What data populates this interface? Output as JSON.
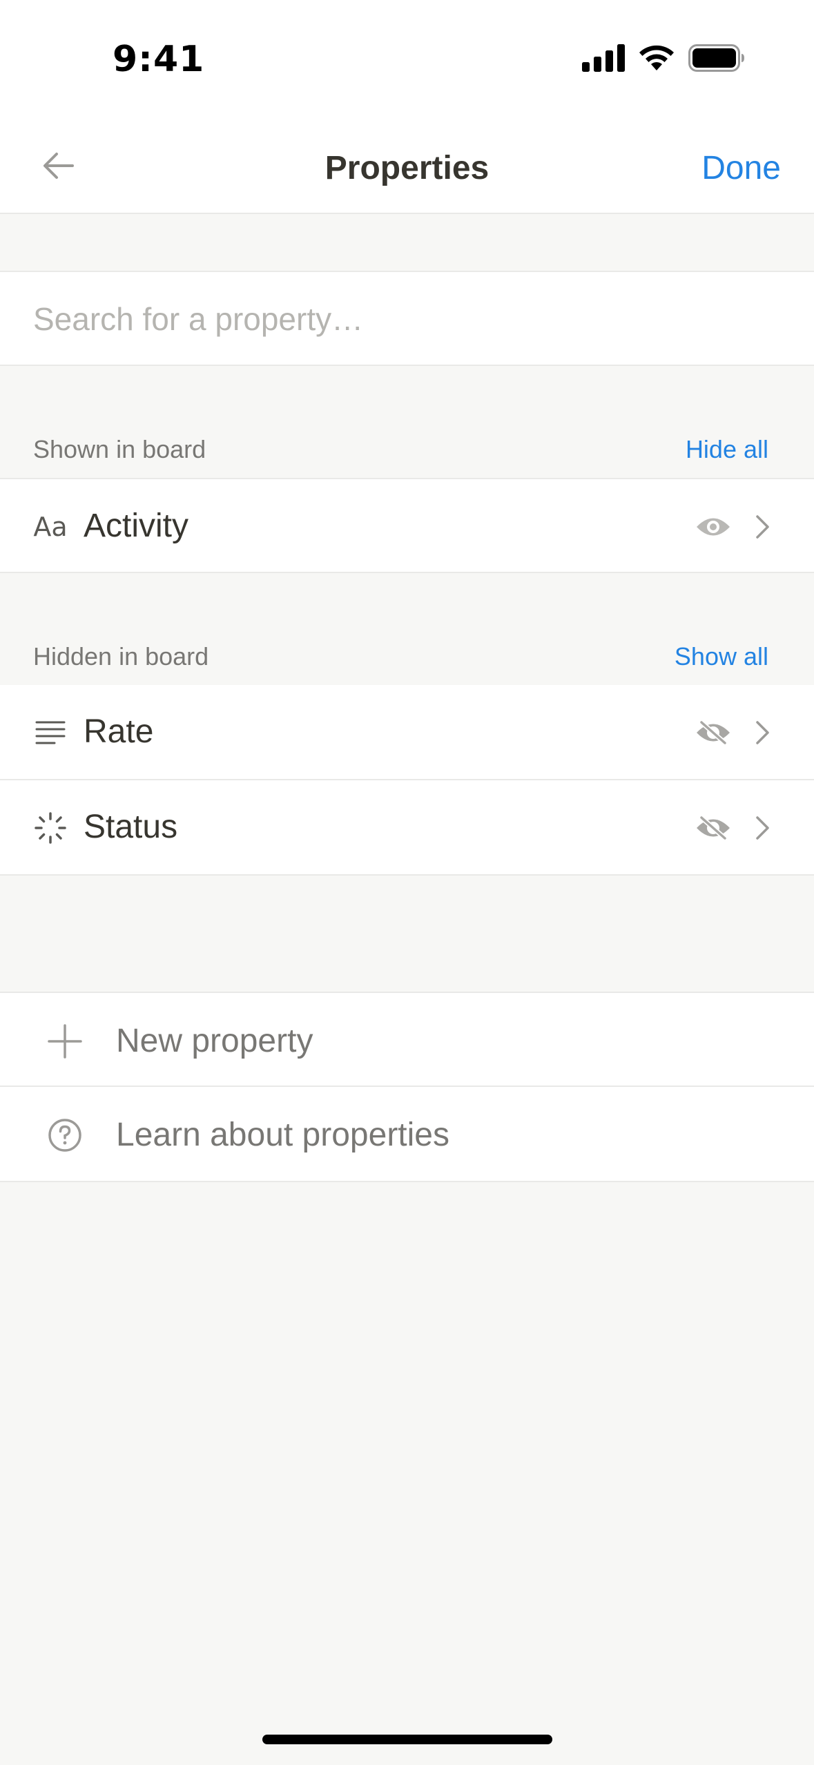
{
  "status_bar": {
    "time": "9:41"
  },
  "nav": {
    "title": "Properties",
    "done_label": "Done"
  },
  "search": {
    "placeholder": "Search for a property…",
    "value": ""
  },
  "shown_section": {
    "label": "Shown in board",
    "action": "Hide all",
    "items": [
      {
        "icon": "text-aa-icon",
        "icon_text": "Aa",
        "label": "Activity",
        "visibility": "shown"
      }
    ]
  },
  "hidden_section": {
    "label": "Hidden in board",
    "action": "Show all",
    "items": [
      {
        "icon": "text-lines-icon",
        "label": "Rate",
        "visibility": "hidden"
      },
      {
        "icon": "status-loader-icon",
        "label": "Status",
        "visibility": "hidden"
      }
    ]
  },
  "actions": [
    {
      "icon": "plus-icon",
      "label": "New property"
    },
    {
      "icon": "question-circle-icon",
      "label": "Learn about properties"
    }
  ],
  "colors": {
    "accent": "#2383e2",
    "background": "#f7f7f5",
    "text": "#37352f",
    "muted": "#787774"
  }
}
